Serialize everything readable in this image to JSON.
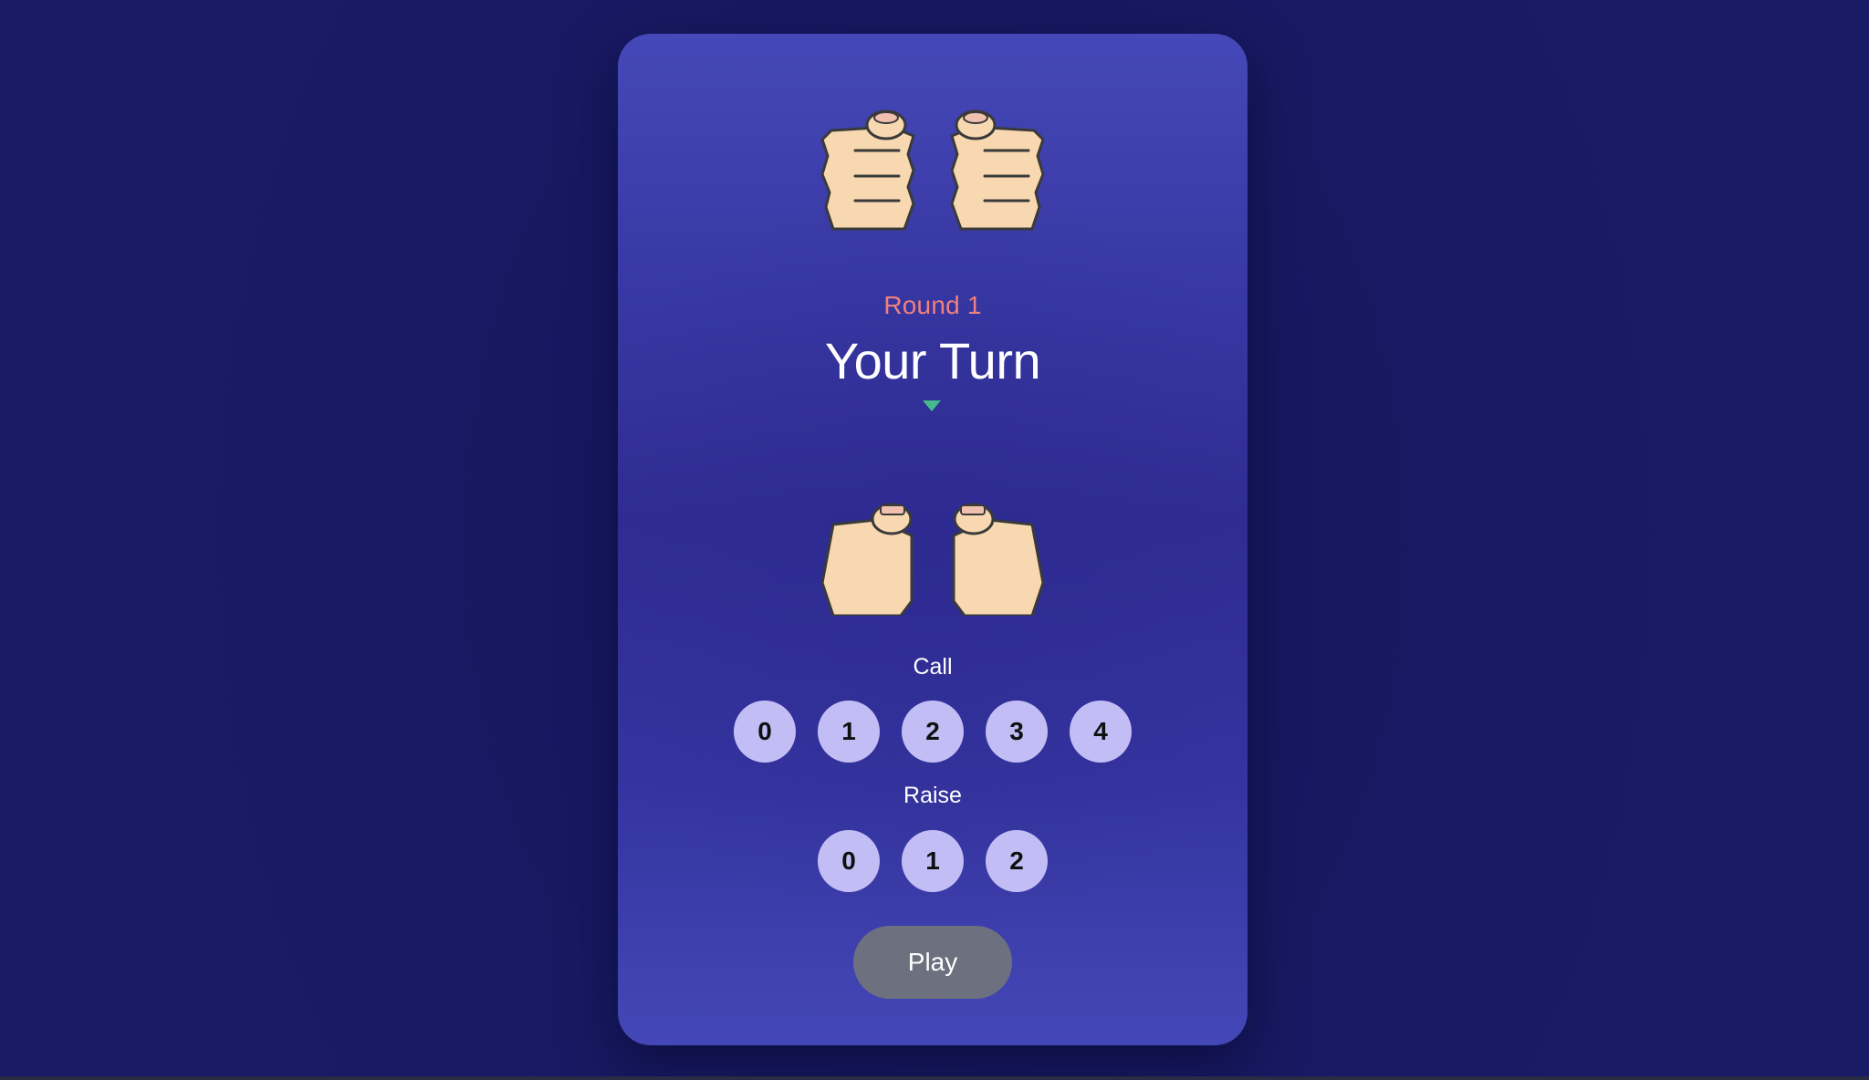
{
  "game": {
    "round_label": "Round 1",
    "turn_title": "Your Turn"
  },
  "opponent": {
    "hands": [
      {
        "side": "left",
        "state": "closed-fist",
        "icon": "closed-fist-icon"
      },
      {
        "side": "right",
        "state": "closed-fist",
        "icon": "closed-fist-icon"
      }
    ]
  },
  "player": {
    "hands": [
      {
        "side": "left",
        "state": "thumb-up",
        "icon": "thumb-fist-icon"
      },
      {
        "side": "right",
        "state": "thumb-up",
        "icon": "thumb-fist-icon"
      }
    ]
  },
  "call": {
    "label": "Call",
    "options": [
      "0",
      "1",
      "2",
      "3",
      "4"
    ]
  },
  "raise": {
    "label": "Raise",
    "options": [
      "0",
      "1",
      "2"
    ]
  },
  "play": {
    "label": "Play"
  },
  "colors": {
    "background": "#171860",
    "card_top": "#4548b8",
    "card_mid": "#2f2d93",
    "round_label": "#f2807d",
    "turn_indicator": "#44b98c",
    "number_button": "#c3bdf5",
    "play_button": "#6d717f",
    "skin": "#f8d8b0",
    "outline": "#3a3a3a"
  }
}
